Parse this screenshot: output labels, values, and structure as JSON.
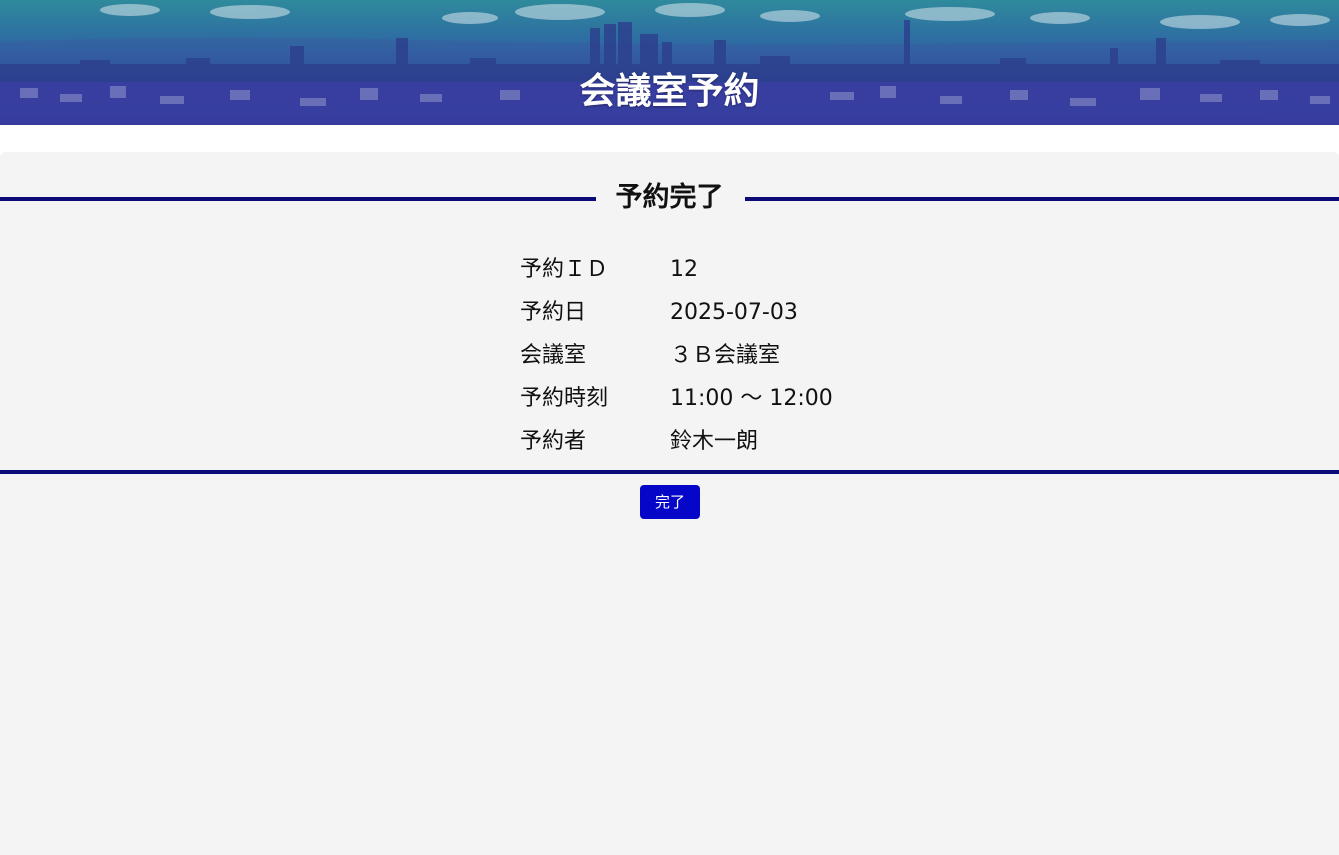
{
  "header": {
    "title": "会議室予約"
  },
  "section": {
    "title": "予約完了"
  },
  "details": [
    {
      "label": "予約ＩＤ",
      "value": "12"
    },
    {
      "label": "予約日",
      "value": "2025-07-03"
    },
    {
      "label": "会議室",
      "value": "３Ｂ会議室"
    },
    {
      "label": "予約時刻",
      "value": "11:00 〜 12:00"
    },
    {
      "label": "予約者",
      "value": "鈴木一朗"
    }
  ],
  "actions": {
    "done_label": "完了"
  },
  "colors": {
    "accent_line": "#0a0a78",
    "button_bg": "#0606c9",
    "background": "#f4f4f4"
  }
}
